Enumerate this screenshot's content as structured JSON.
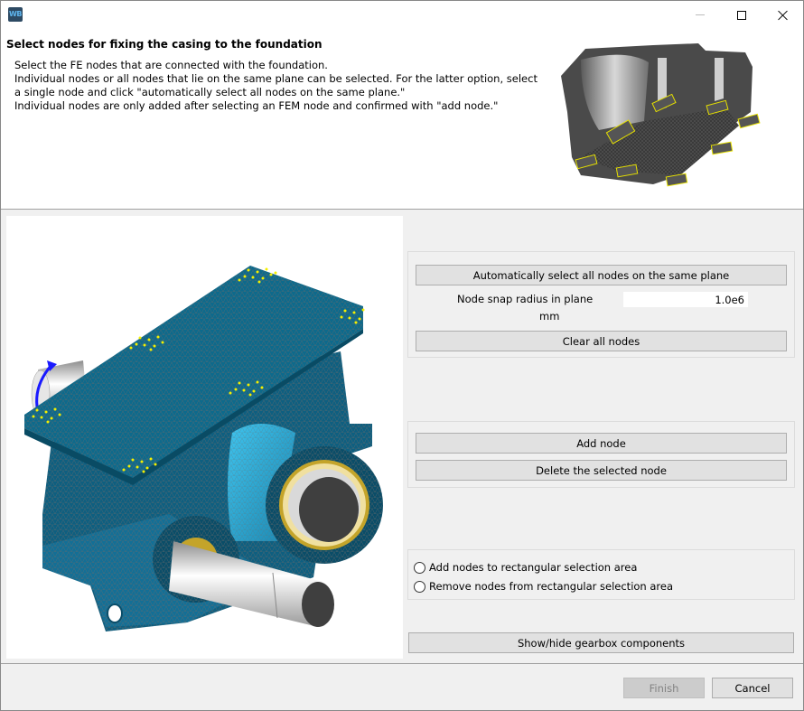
{
  "window": {
    "app_icon_text": "WB",
    "controls": [
      "minimize",
      "maximize",
      "close"
    ]
  },
  "header": {
    "title": "Select nodes for fixing the casing to the foundation",
    "description": [
      "Select the FE nodes that are connected with the foundation.",
      "Individual nodes or all nodes that lie on the same plane can be selected. For the latter option, select",
      "a single node and click \"automatically select all nodes on the same plane.\"",
      "Individual nodes are only added after selecting an FEM node and confirmed with \"add node.\""
    ],
    "image": "gearbox-casing-underside-mesh-preview"
  },
  "viewport": {
    "image": "gearbox-fe-mesh-3d-view",
    "colors": {
      "mesh": "#0e6f93",
      "nodes": "#f5f000",
      "rotation_arrow": "#1a1aff"
    }
  },
  "plane_group": {
    "auto_select_button": "Automatically select all nodes on the same plane",
    "snap_radius_label": "Node snap radius in plane",
    "snap_radius_unit": "mm",
    "snap_radius_value": "1.0e6",
    "clear_button": "Clear all nodes"
  },
  "node_group": {
    "add_button": "Add node",
    "delete_button": "Delete the selected node"
  },
  "selection_group": {
    "options": [
      {
        "label": "Add nodes to rectangular selection area",
        "checked": false
      },
      {
        "label": "Remove nodes from rectangular selection area",
        "checked": false
      }
    ]
  },
  "show_hide_button": "Show/hide gearbox components",
  "footer": {
    "finish_button": "Finish",
    "finish_enabled": false,
    "cancel_button": "Cancel"
  }
}
